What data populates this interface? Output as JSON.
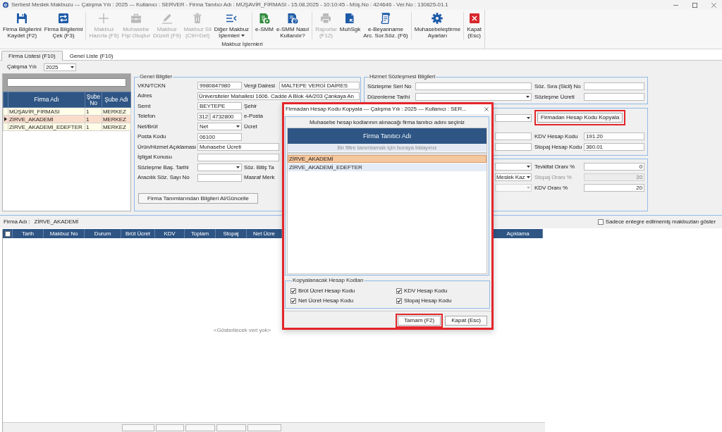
{
  "window": {
    "title": "Serbest Meslek Makbuzu --- Çalışma Yılı : 2025 --- Kullanıcı : SERVER - Firma Tanıtıcı Adı : MÜŞAVİR_FİRMASI - 15.08.2025 - 10:10:45 - Müş.No : 424646 - Ver.No : 130825-01.1"
  },
  "ribbon": {
    "group_label": "Makbuz İşlemleri",
    "sections": [
      {
        "buttons": [
          {
            "kind": "save",
            "label": "Firma Bilgilerini\nKaydet (F2)",
            "disabled": false,
            "dropdown": false
          },
          {
            "kind": "sync",
            "label": "Firma Bilgilerini\nÇek (F3)",
            "disabled": false,
            "dropdown": false
          }
        ]
      },
      {
        "buttons": [
          {
            "kind": "add",
            "label": "Makbuz\nHazırla (F5)",
            "disabled": true,
            "dropdown": false
          },
          {
            "kind": "briefcase",
            "label": "Muhasebe\nFişi Oluştur",
            "disabled": true,
            "dropdown": false
          },
          {
            "kind": "edit",
            "label": "Makbuz\nDüzelt (F9)",
            "disabled": true,
            "dropdown": false
          },
          {
            "kind": "delete",
            "label": "Makbuz Sil\n(Ctrl+Del)",
            "disabled": true,
            "dropdown": false
          },
          {
            "kind": "list",
            "label": "Diğer Makbuz\nİşlemleri",
            "disabled": false,
            "dropdown": true
          }
        ]
      },
      {
        "buttons": [
          {
            "kind": "esmm",
            "label": "e-SMM",
            "disabled": false,
            "dropdown": false
          },
          {
            "kind": "help",
            "label": "e-SMM Nasıl\nKullanılır?",
            "disabled": false,
            "dropdown": false
          }
        ]
      },
      {
        "buttons": [
          {
            "kind": "print",
            "label": "Raporlar\n(F12)",
            "disabled": true,
            "dropdown": false
          },
          {
            "kind": "muhsgk",
            "label": "MuhSgk",
            "disabled": false,
            "dropdown": false
          },
          {
            "kind": "declaration",
            "label": "e-Beyanname\nArc. Sor.Söz. (F6)",
            "disabled": false,
            "dropdown": false
          }
        ]
      },
      {
        "buttons": [
          {
            "kind": "settings",
            "label": "Muhasebeleştirme\nAyarları",
            "disabled": false,
            "dropdown": false
          }
        ]
      },
      {
        "buttons": [
          {
            "kind": "close",
            "label": "Kapat\n(Esc)",
            "disabled": false,
            "dropdown": false
          }
        ]
      }
    ]
  },
  "tabs": [
    {
      "label": "Firma Listesi (F10)",
      "selected": true
    },
    {
      "label": "Genel Liste (F10)",
      "selected": false
    }
  ],
  "year": {
    "label": "Çalışma Yılı",
    "value": "2025"
  },
  "firm_list": {
    "columns": [
      "Firma Adı",
      "Şube No",
      "Şube Adı"
    ],
    "rows": [
      {
        "cells": [
          "MÜŞAVİR_FİRMASI",
          "1",
          "MERKEZ"
        ],
        "selected": false
      },
      {
        "cells": [
          "ZİRVE_AKADEMİ",
          "1",
          "MERKEZ"
        ],
        "selected": true
      },
      {
        "cells": [
          "ZİRVE_AKADEMİ_EDEFTER",
          "1",
          "MERKEZ"
        ],
        "selected": false
      }
    ]
  },
  "general_info": {
    "title": "Genel Bilgiler",
    "rows": [
      {
        "left": {
          "label": "VKN/TCKN",
          "kind": "text",
          "value": "9980847980"
        },
        "right": {
          "label": "Vergi Dairesi",
          "kind": "text",
          "value": "MALTEPE VERGİ DAİRES"
        }
      },
      {
        "left": {
          "label": "Adres",
          "kind": "wide",
          "value": "Üniversiteler Mahallesi 1606. Cadde A Blok 4A/203 Çankaya An"
        }
      },
      {
        "left": {
          "label": "Semt",
          "kind": "text",
          "value": "BEYTEPE"
        },
        "right": {
          "label": "Şehir"
        }
      },
      {
        "left": {
          "label": "Telefon",
          "kind": "phone",
          "area_code": "312",
          "value": "4732800"
        },
        "right": {
          "label": "e-Posta"
        }
      },
      {
        "left": {
          "label": "Net/Brüt",
          "kind": "combo",
          "value": "Net"
        },
        "right": {
          "label": "Ücret"
        }
      },
      {
        "left": {
          "label": "Posta Kodu",
          "kind": "text",
          "value": "06100"
        }
      },
      {
        "left": {
          "label": "Ürün/Hizmet Açıklaması",
          "kind": "long",
          "value": "Muhasebe Ücreti"
        }
      },
      {
        "left": {
          "label": "İştigal Konusu",
          "kind": "long"
        }
      },
      {
        "left": {
          "label": "Sözleşme Baş. Tarihi",
          "kind": "combo"
        },
        "right": {
          "label": "Söz. Bitiş Ta"
        }
      },
      {
        "left": {
          "label": "Aracılık Söz. Sayı No",
          "kind": "text"
        },
        "right": {
          "label": "Masraf Merk"
        }
      }
    ],
    "button": "Firma Tanımlarından Bilgileri Al/Güncelle"
  },
  "contract": {
    "title": "Hizmet Sözleşmesi Bilgileri",
    "rows": [
      [
        {
          "label": "Sözleşme Seri No",
          "kind": "text"
        },
        {
          "label": "Söz. Sıra (Sicil) No",
          "kind": "text"
        }
      ],
      [
        {
          "label": "Düzenleme Tarihi",
          "kind": "combo"
        },
        {
          "label": "Sözleşme Ücreti",
          "kind": "text"
        }
      ]
    ]
  },
  "account_codes": {
    "rows": [
      {
        "control": {
          "kind": "combo"
        },
        "button": {
          "label": "Firmadan Hesap Kodu Kopyala",
          "highlighted": true
        }
      },
      {
        "control": {
          "kind": "text"
        },
        "label": "KDV Hesap Kodu",
        "value": "191.20"
      },
      {
        "control": {
          "kind": "text"
        },
        "label": "Stopaj Hesap Kodu",
        "value": "360.01"
      }
    ]
  },
  "rates": {
    "rows": [
      {
        "control": {
          "kind": "combo",
          "disabled": false
        },
        "label": "Tevkifat Oranı %",
        "value": "0",
        "disabled": false
      },
      {
        "control": {
          "kind": "combo",
          "value": "Meslek Kaz",
          "disabled": false
        },
        "label": "Stopaj Oranı %",
        "value": "20",
        "disabled": true
      },
      {
        "control": {
          "kind": "combo",
          "disabled": true
        },
        "label": "KDV Oranı %",
        "value": "20",
        "disabled": false
      }
    ]
  },
  "invoices": {
    "firm_label": "Firma Adı :",
    "firm_value": "ZİRVE_AKADEMİ",
    "filter": {
      "label": "Sadece entegre edilmemiş makbuzları göster",
      "checked": false
    },
    "select_all": {
      "checked": false
    },
    "columns": [
      {
        "label": "Tarih",
        "summary": false
      },
      {
        "label": "Makbuz No",
        "summary": false
      },
      {
        "label": "Durum",
        "summary": false
      },
      {
        "label": "Brüt Ücret",
        "summary": true
      },
      {
        "label": "KDV",
        "summary": true
      },
      {
        "label": "Toplam",
        "summary": true
      },
      {
        "label": "Stopaj",
        "summary": true
      },
      {
        "label": "Net Ücre",
        "summary": true
      },
      {
        "label": "Açıklama",
        "summary": false
      }
    ],
    "empty_text": "<Gösterilecek veri yok>"
  },
  "dialog": {
    "title": "Firmadan Hesap Kodu Kopyala --- Çalışma Yılı : 2025 --- Kullanıcı : SER...",
    "highlighted": true,
    "prompt": "Muhasebe hesap kodlarının alınacağı firma tanıtıcı adını seçiniz",
    "column": "Firma Tanıtıcı Adı",
    "filter_hint": "Bir filtre tanımlamak için buraya tıklayınız",
    "rows": [
      {
        "name": "ZİRVE_AKADEMİ",
        "selected": true
      },
      {
        "name": "ZİRVE_AKADEMİ_EDEFTER",
        "selected": false
      }
    ],
    "copy_group": {
      "title": "Kopyalanacak Hesap Kodları",
      "options": [
        {
          "label": "Brüt Ücret Hesap Kodu",
          "checked": true
        },
        {
          "label": "KDV Hesap Kodu",
          "checked": true
        },
        {
          "label": "Net Ücret Hesap Kodu",
          "checked": true
        },
        {
          "label": "Stopaj Hesap Kodu",
          "checked": true
        }
      ]
    },
    "buttons": [
      {
        "label": "Tamam (F2)",
        "highlighted": true
      },
      {
        "label": "Kapat (Esc)",
        "highlighted": false
      }
    ]
  }
}
